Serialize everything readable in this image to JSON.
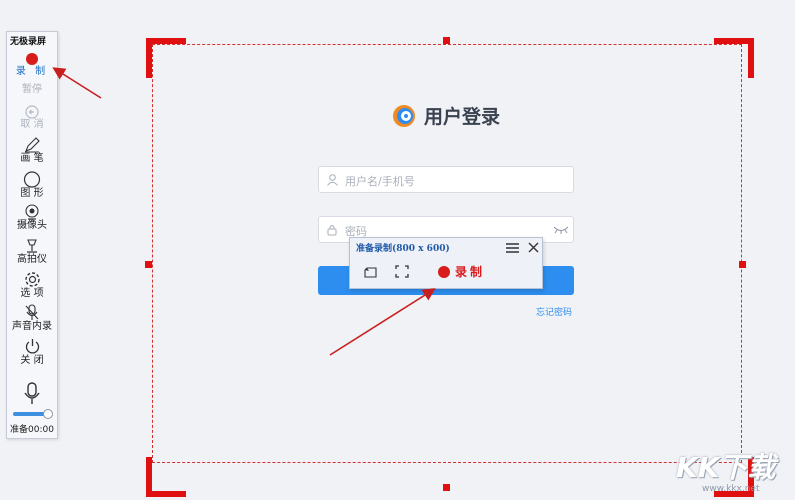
{
  "toolbar": {
    "title": "无极录屏",
    "record": "录 制",
    "pause": "暂停",
    "cancel": "取 消",
    "brush": "画 笔",
    "shape": "图 形",
    "camera": "摄像头",
    "document_camera": "高拍仪",
    "options": "选 项",
    "audio_record": "声音内录",
    "close": "关 闭",
    "status": "准备00:00"
  },
  "login": {
    "title": "用户登录",
    "username_placeholder": "用户名/手机号",
    "password_placeholder": "密码",
    "forgot": "忘记密码"
  },
  "rec_panel": {
    "title": "准备录制(800 x 600)",
    "record": "录制"
  },
  "watermark": {
    "brand": "KK下载",
    "url": "www.kkx.net"
  },
  "colors": {
    "accent_red": "#e01010",
    "record_red": "#d81c1c",
    "brand_blue": "#2d8ef0"
  },
  "icons": [
    "record-dot-icon",
    "pause-icon",
    "cancel-icon",
    "brush-icon",
    "shape-icon",
    "camera-icon",
    "document-camera-icon",
    "gear-icon",
    "mic-off-icon",
    "power-icon",
    "mic-icon",
    "user-icon",
    "lock-icon",
    "eye-closed-icon",
    "menu-icon",
    "close-icon",
    "window-icon",
    "fullscreen-icon"
  ]
}
